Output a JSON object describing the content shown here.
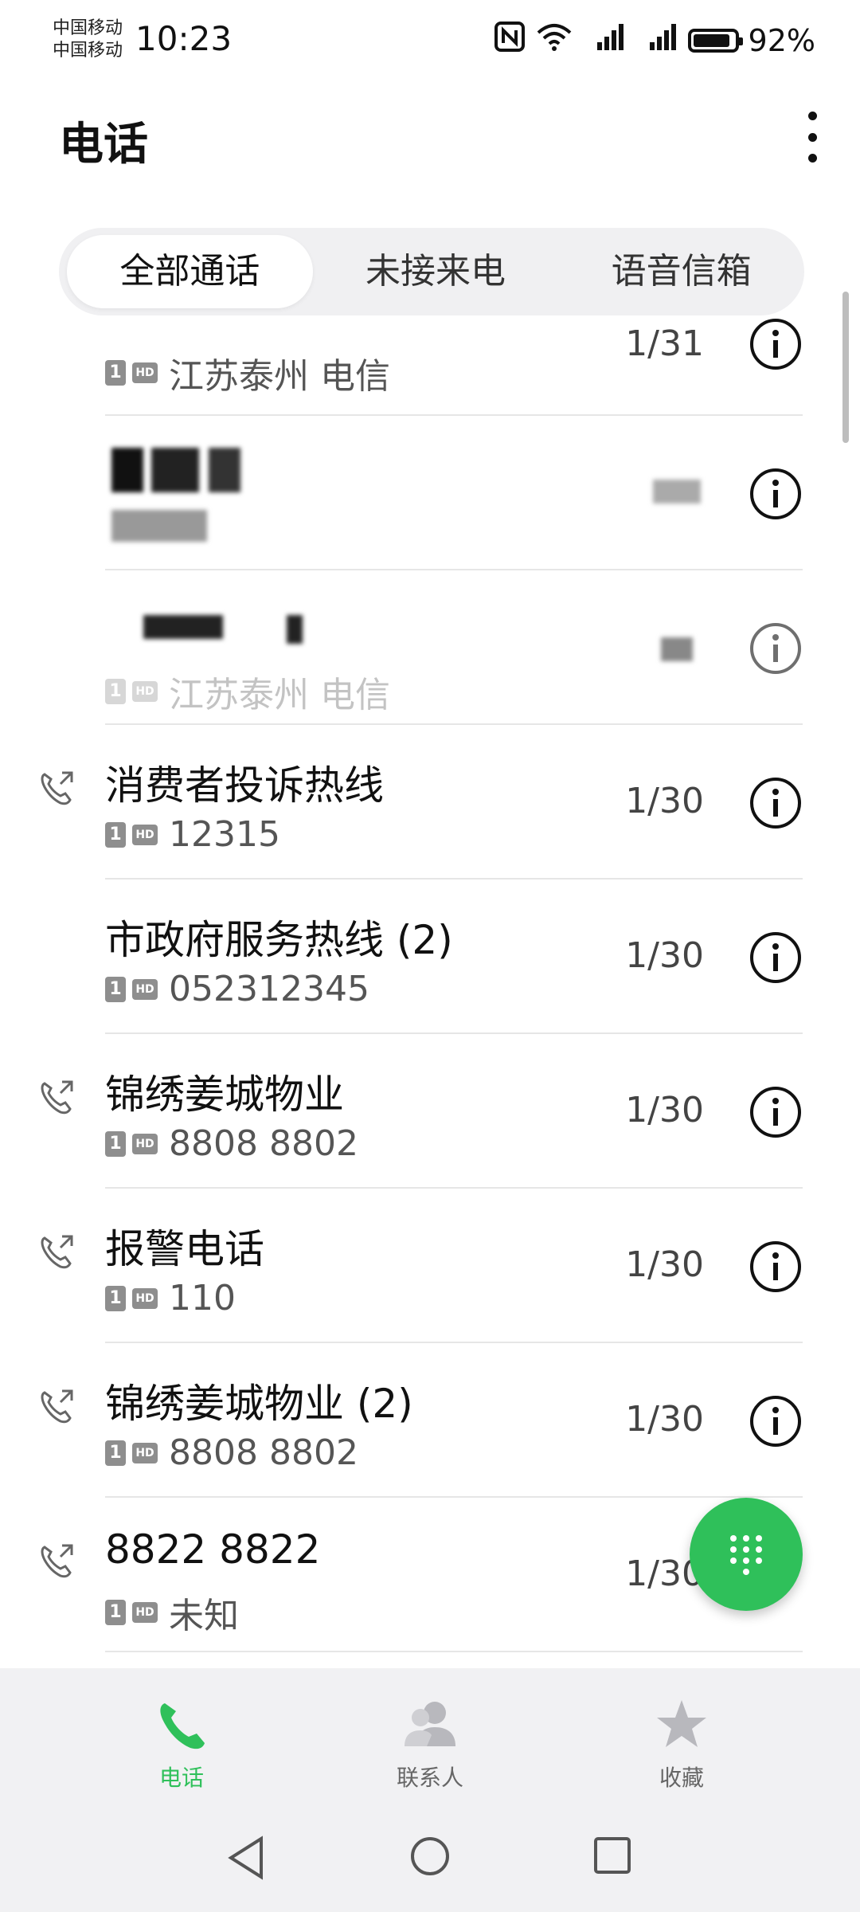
{
  "status_bar": {
    "carrier_1": "中国移动",
    "carrier_2": "中国移动",
    "time": "10:23",
    "battery": "92%"
  },
  "header": {
    "title": "电话"
  },
  "tabs": [
    {
      "label": "全部通话"
    },
    {
      "label": "未接来电"
    },
    {
      "label": "语音信箱"
    }
  ],
  "calls": [
    {
      "sub": "江苏泰州 电信",
      "date": "1/31"
    },
    {
      "name": "",
      "sub": "",
      "date": ""
    },
    {
      "name": "",
      "sub": "江苏泰州 电信",
      "date": ""
    },
    {
      "name": "消费者投诉热线",
      "sub": "12315",
      "date": "1/30"
    },
    {
      "name": "市政府服务热线 (2)",
      "sub": "052312345",
      "date": "1/30"
    },
    {
      "name": "锦绣姜城物业",
      "sub": "8808 8802",
      "date": "1/30"
    },
    {
      "name": "报警电话",
      "sub": "110",
      "date": "1/30"
    },
    {
      "name": "锦绣姜城物业 (2)",
      "sub": "8808 8802",
      "date": "1/30"
    },
    {
      "name": "8822 8822",
      "sub": "未知",
      "date": "1/30"
    }
  ],
  "badges": {
    "sim": "1",
    "hd": "HD"
  },
  "bottom_nav": [
    {
      "label": "电话"
    },
    {
      "label": "联系人"
    },
    {
      "label": "收藏"
    }
  ],
  "colors": {
    "accent": "#2fc05a"
  },
  "icons": {
    "fab": "dialpad-icon",
    "info": "info-icon",
    "call": "outgoing-call-icon"
  }
}
